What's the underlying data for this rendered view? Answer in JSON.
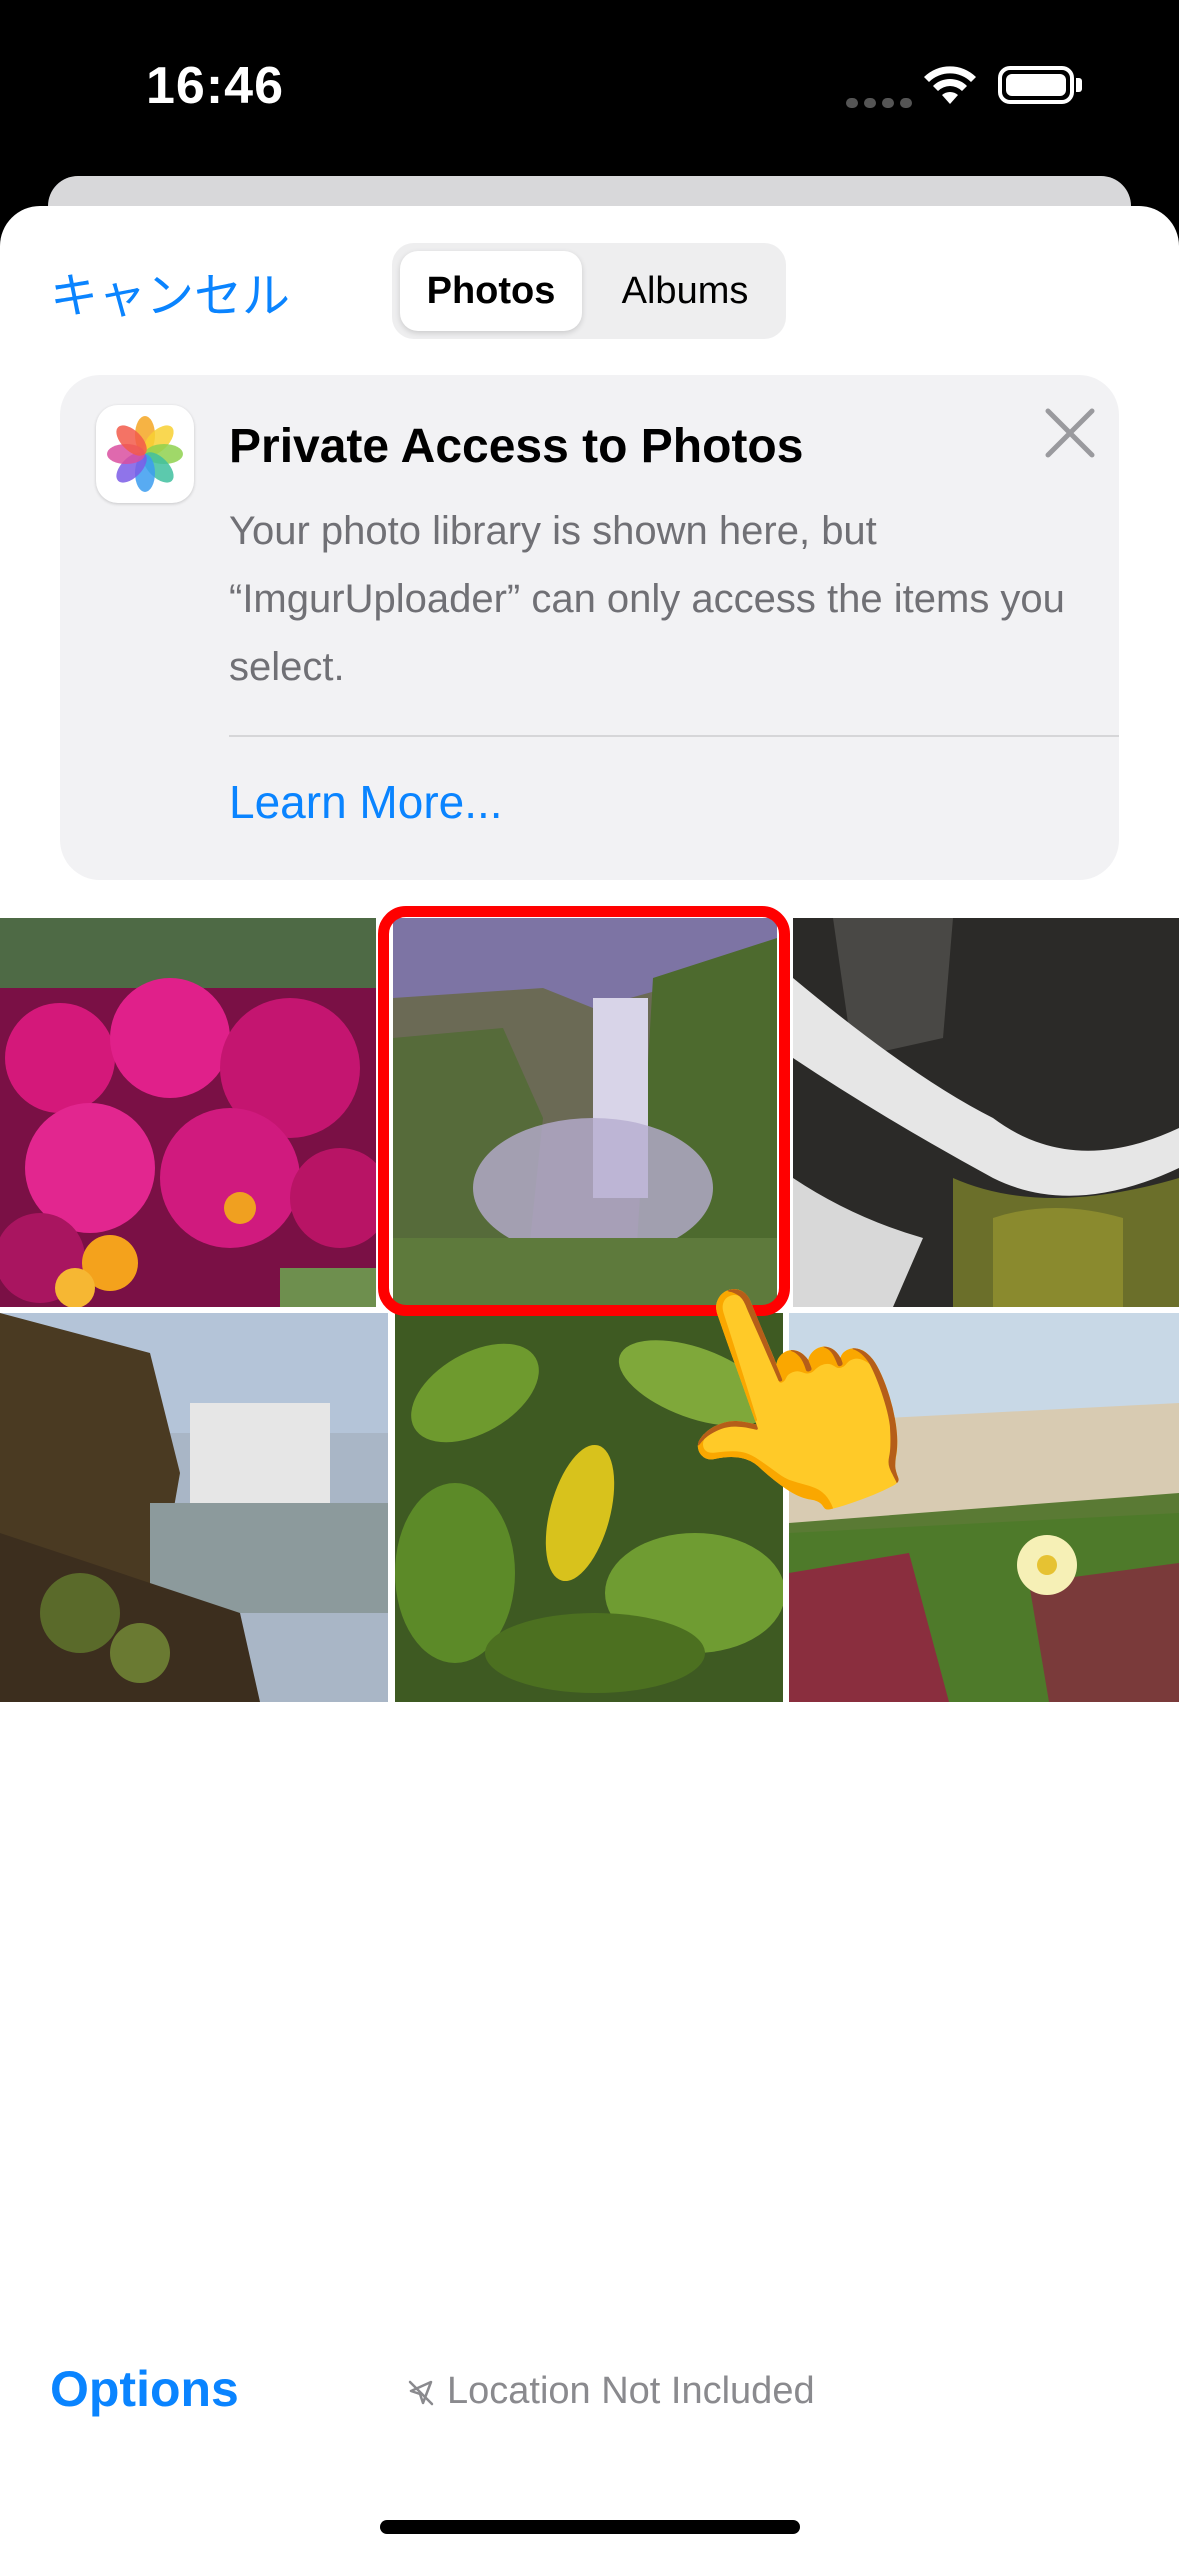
{
  "status_bar": {
    "time": "16:46"
  },
  "nav": {
    "cancel_label": "キャンセル"
  },
  "segmented_control": {
    "photos_label": "Photos",
    "albums_label": "Albums",
    "selected": "Photos"
  },
  "banner": {
    "title": "Private Access to Photos",
    "body": "Your photo library is shown here, but “ImgurUploader” can only access the items you select.",
    "learn_more_label": "Learn More..."
  },
  "photos": [
    {
      "name": "pink-flowers"
    },
    {
      "name": "waterfall-cliff"
    },
    {
      "name": "waterfall-rocks"
    },
    {
      "name": "waterfall-river"
    },
    {
      "name": "green-leaves"
    },
    {
      "name": "ice-plant-flower"
    }
  ],
  "footer": {
    "options_label": "Options",
    "location_label": "Location Not Included"
  },
  "colors": {
    "accent": "#0a84ff",
    "highlight": "#ff0000"
  }
}
